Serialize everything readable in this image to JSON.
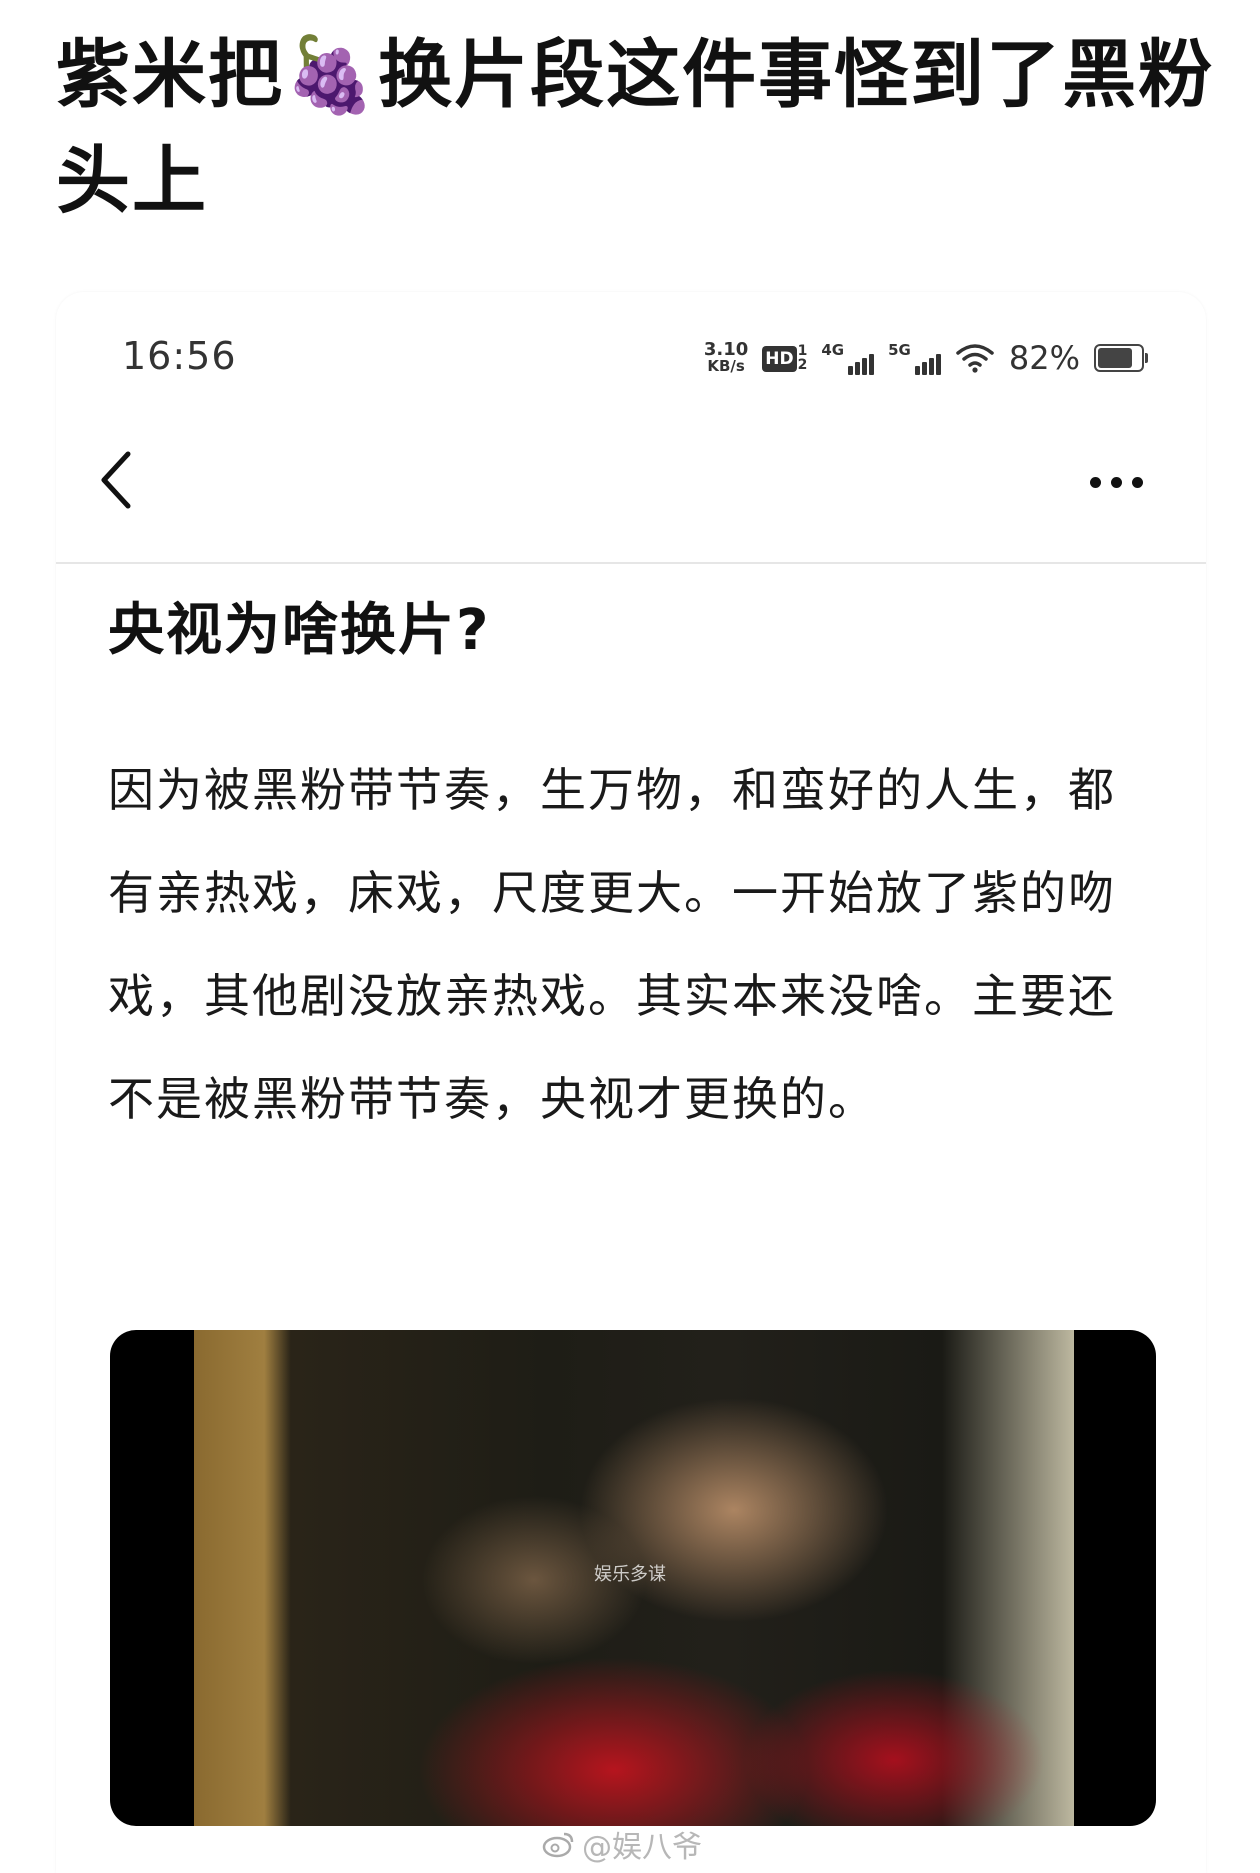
{
  "post": {
    "title": "紫米把🍇换片段这件事怪到了黑粉头上"
  },
  "status_bar": {
    "time": "16:56",
    "net_speed_value": "3.10",
    "net_speed_unit": "KB/s",
    "hd_label": "HD",
    "hd_sub": "1",
    "hd_sub2": "2",
    "signal1_label": "4G",
    "signal2_label": "5G",
    "battery_percent": "82%",
    "battery_level": 0.82
  },
  "nav": {
    "back_icon": "chevron-left-icon",
    "more_icon": "more-horizontal-icon"
  },
  "article": {
    "title": "央视为啥换片?",
    "body": "因为被黑粉带节奏，生万物，和蛮好的人生，都有亲热戏，床戏，尺度更大。一开始放了紫的吻戏，其他剧没放亲热戏。其实本来没啥。主要还不是被黑粉带节奏，央视才更换的。"
  },
  "video": {
    "watermark": "娱乐多谋"
  },
  "footer": {
    "weibo_watermark": "@娱八爷"
  }
}
